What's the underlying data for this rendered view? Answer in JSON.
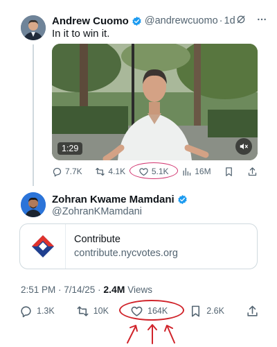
{
  "quoted_tweet": {
    "author_name": "Andrew Cuomo",
    "handle": "@andrewcuomo",
    "separator": "·",
    "time_ago": "1d",
    "text": "In it to win it.",
    "video_duration": "1:29",
    "actions": {
      "replies": "7.7K",
      "reposts": "4.1K",
      "likes": "5.1K",
      "views": "16M"
    },
    "icons": [
      "grok-icon",
      "more-icon",
      "mute-icon",
      "reply-icon",
      "repost-icon",
      "heart-icon",
      "views-icon",
      "bookmark-icon",
      "share-icon"
    ]
  },
  "main_tweet": {
    "author_name": "Zohran Kwame Mamdani",
    "handle": "@ZohranKMamdani",
    "card": {
      "title": "Contribute",
      "url": "contribute.nycvotes.org"
    },
    "timestamp": "2:51 PM · 7/14/25 · ",
    "views_count": "2.4M",
    "views_label": " Views",
    "actions": {
      "replies": "1.3K",
      "reposts": "10K",
      "likes": "164K",
      "bookmarks": "2.6K"
    }
  },
  "colors": {
    "verified_blue": "#1d9bf0",
    "annotation_pink": "#d1316d",
    "annotation_red": "#d0232a",
    "muted_text": "#536471"
  }
}
